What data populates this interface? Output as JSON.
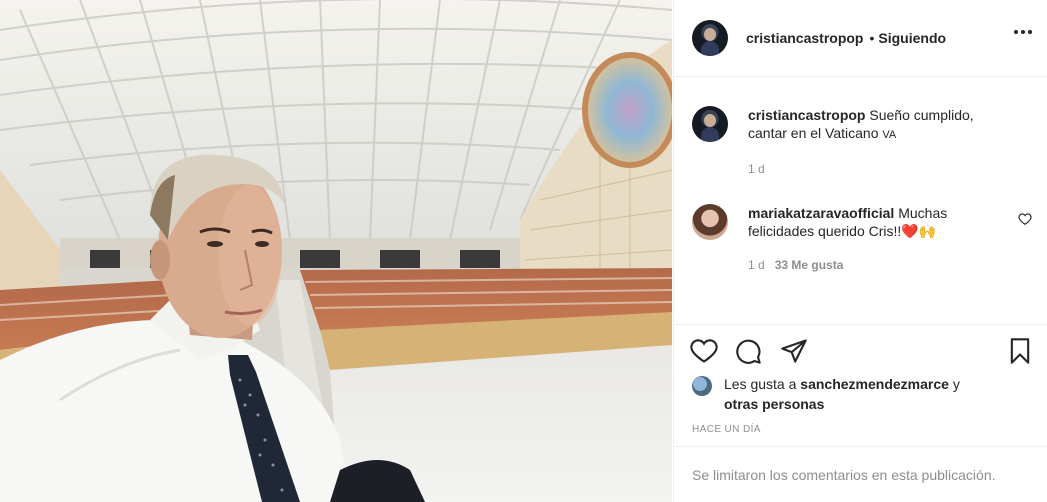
{
  "post": {
    "username": "cristiancastropop",
    "separator": "•",
    "follow_status": "Siguiendo"
  },
  "caption": {
    "username": "cristiancastropop",
    "text": "Sueño cumplido, cantar en el Vaticano",
    "badge": "VA",
    "time": "1 d"
  },
  "comments": [
    {
      "username": "mariakatzaravaofficial",
      "text": "Muchas felicidades querido Cris!!",
      "emoji": "❤️🙌",
      "time": "1 d",
      "likes": "33 Me gusta"
    }
  ],
  "likes": {
    "prefix": "Les gusta a",
    "user": "sanchezmendezmarce",
    "connector": "y",
    "others": "otras personas"
  },
  "timestamp": "HACE UN DÍA",
  "footer": {
    "comments_disabled": "Se limitaron los comentarios en esta publicación."
  },
  "icons": {
    "like": "heart-icon",
    "comment": "comment-icon",
    "share": "paper-plane-icon",
    "save": "bookmark-icon",
    "more": "more-options-icon"
  }
}
